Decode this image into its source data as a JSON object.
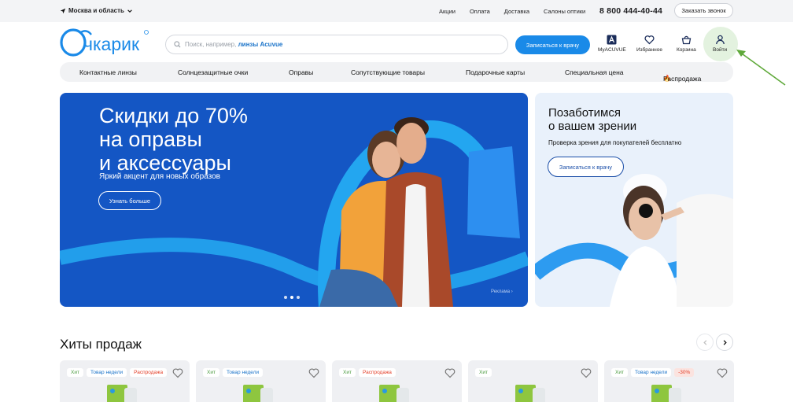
{
  "topbar": {
    "location": "Москва и область",
    "links": [
      "Акции",
      "Оплата",
      "Доставка",
      "Салоны оптики"
    ],
    "phone": "8 800 444-40-44",
    "callback": "Заказать звонок"
  },
  "header": {
    "logo_text": "Очкарик",
    "search_placeholder_prefix": "Поиск, например,",
    "search_placeholder_example": "линзы Acuvue",
    "doctor_button": "Записаться к врачу",
    "icons": [
      {
        "label": "MyACUVUE",
        "icon": "acuvue-icon"
      },
      {
        "label": "Избранное",
        "icon": "heart-icon"
      },
      {
        "label": "Корзина",
        "icon": "basket-icon"
      },
      {
        "label": "Войти",
        "icon": "user-icon"
      }
    ]
  },
  "categories": [
    "Контактные линзы",
    "Солнцезащитные очки",
    "Оправы",
    "Сопутствующие товары",
    "Подарочные карты",
    "Специальная цена",
    "Распродажа"
  ],
  "main_banner": {
    "title": "Скидки до 70%\nна оправы\nи аксессуары",
    "subtitle": "Яркий акцент для новых образов",
    "button": "Узнать больше",
    "ad_label": "Реклама",
    "slide_count": 3
  },
  "side_banner": {
    "title": "Позаботимся\nо вашем зрении",
    "text": "Проверка зрения для покупателей бесплатно",
    "button": "Записаться к врачу"
  },
  "hits": {
    "title": "Хиты продаж",
    "cards": [
      {
        "tags": [
          {
            "text": "Хит",
            "kind": "hit"
          },
          {
            "text": "Товар недели",
            "kind": "week"
          },
          {
            "text": "Распродажа",
            "kind": "sale"
          }
        ]
      },
      {
        "tags": [
          {
            "text": "Хит",
            "kind": "hit"
          },
          {
            "text": "Товар недели",
            "kind": "week"
          }
        ]
      },
      {
        "tags": [
          {
            "text": "Хит",
            "kind": "hit"
          },
          {
            "text": "Распродажа",
            "kind": "sale"
          }
        ]
      },
      {
        "tags": [
          {
            "text": "Хит",
            "kind": "hit"
          }
        ]
      },
      {
        "tags": [
          {
            "text": "Хит",
            "kind": "hit"
          },
          {
            "text": "Товар недели",
            "kind": "week"
          },
          {
            "text": "-30%",
            "kind": "pct"
          }
        ]
      }
    ]
  },
  "colors": {
    "brand_blue": "#1a8ae8",
    "banner_blue": "#1456c4",
    "sale_red": "#e4402a",
    "hit_green": "#4a9a3e"
  }
}
